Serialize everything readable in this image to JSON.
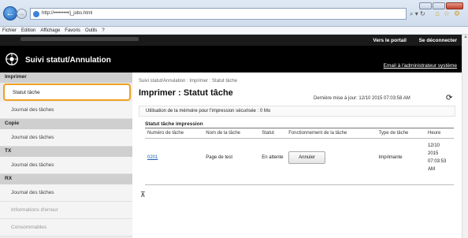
{
  "browser": {
    "url": "http://•••••••••/j_jobs.html",
    "search_tools": "⌕ ▾ ↻",
    "menu": [
      "Fichier",
      "Edition",
      "Affichage",
      "Favoris",
      "Outils",
      "?"
    ]
  },
  "app": {
    "portal_link": "Vers le portail",
    "logout_link": "Se déconnecter",
    "title": "Suivi statut/Annulation",
    "admin_email": "Email à l'administrateur système"
  },
  "sidebar": [
    {
      "type": "head",
      "label": "Imprimer"
    },
    {
      "type": "item",
      "label": "Statut tâche",
      "active": true
    },
    {
      "type": "item",
      "label": "Journal des tâches"
    },
    {
      "type": "head",
      "label": "Copie"
    },
    {
      "type": "item",
      "label": "Journal des tâches"
    },
    {
      "type": "head",
      "label": "TX"
    },
    {
      "type": "item",
      "label": "Journal des tâches"
    },
    {
      "type": "head",
      "label": "RX"
    },
    {
      "type": "item",
      "label": "Journal des tâches"
    },
    {
      "type": "item",
      "label": "Informations d'erreur",
      "dim": true
    },
    {
      "type": "item",
      "label": "Consommables",
      "dim": true
    }
  ],
  "main": {
    "breadcrumb": "Suivi statut/Annulation : Imprimer : Statut tâche",
    "page_title": "Imprimer : Statut tâche",
    "last_update": "Dernière mise à jour: 12/10 2015 07:03:58 AM",
    "secure_memory": "Utilisation de la mémoire pour l'impression sécurisée :   0 Mo",
    "table_title": "Statut tâche impression",
    "columns": [
      "Numéro de tâche",
      "Nom de la tâche",
      "Statut",
      "Fonctionnement de la tâche",
      "Type de tâche",
      "Heure"
    ],
    "row": {
      "id": "0201",
      "name": "Page de test",
      "status": "En attente",
      "action": "Annuler",
      "type": "Imprimante",
      "time": "12/10 2015 07:03:53 AM"
    }
  }
}
